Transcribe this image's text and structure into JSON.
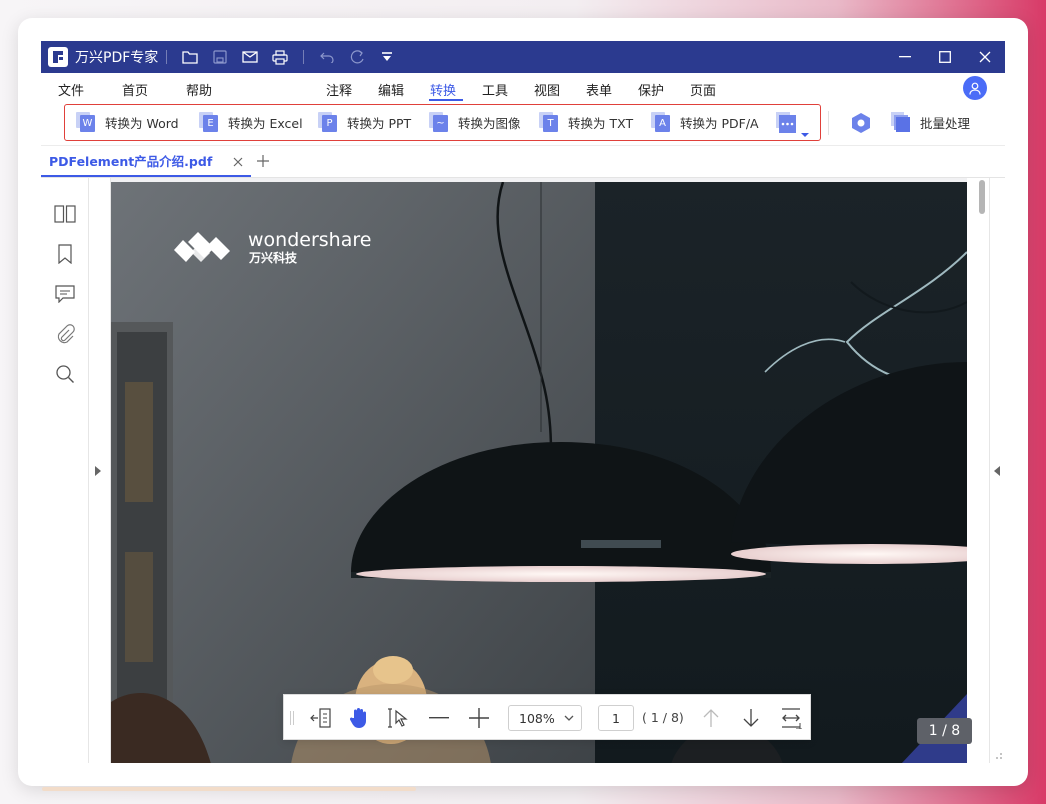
{
  "app": {
    "title": "万兴PDF专家"
  },
  "menu": {
    "items": [
      {
        "label": "文件"
      },
      {
        "label": "首页"
      },
      {
        "label": "帮助"
      },
      {
        "label": "注释"
      },
      {
        "label": "编辑"
      },
      {
        "label": "转换",
        "active": true
      },
      {
        "label": "工具"
      },
      {
        "label": "视图"
      },
      {
        "label": "表单"
      },
      {
        "label": "保护"
      },
      {
        "label": "页面"
      }
    ]
  },
  "toolbar": {
    "convert_buttons": [
      {
        "label": "转换为 Word",
        "icon_letter": "W"
      },
      {
        "label": "转换为 Excel",
        "icon_letter": "E"
      },
      {
        "label": "转换为 PPT",
        "icon_letter": "P"
      },
      {
        "label": "转换为图像",
        "icon_letter": "~"
      },
      {
        "label": "转换为 TXT",
        "icon_letter": "T"
      },
      {
        "label": "转换为 PDF/A",
        "icon_letter": "A"
      }
    ],
    "more_icon": "more-icon",
    "batch_label": "批量处理",
    "accent_color": "#3d5ae6",
    "highlight_border_color": "#e0403a"
  },
  "tabs": [
    {
      "label": "PDFelement产品介绍.pdf",
      "active": true
    }
  ],
  "document": {
    "brand_name": "wondershare",
    "brand_subtitle": "万兴科技"
  },
  "viewer": {
    "zoom": "108%",
    "current_page": "1",
    "page_total": "( 1 / 8)",
    "page_badge": "1 / 8"
  },
  "colors": {
    "titlebar": "#2b3a8f",
    "accent": "#3d5ae6"
  }
}
